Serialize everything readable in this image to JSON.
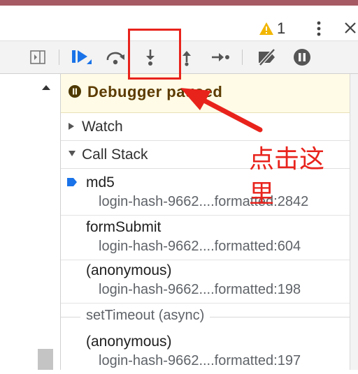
{
  "tabbar": {
    "warning_count": "1",
    "icons": [
      "warning-icon",
      "more-vertical-icon",
      "close-icon"
    ]
  },
  "toolbar": {
    "buttons": [
      {
        "name": "toggle-navigator",
        "icon": "panel-icon"
      },
      {
        "name": "resume",
        "icon": "resume-icon"
      },
      {
        "name": "step-over",
        "icon": "step-over-icon"
      },
      {
        "name": "step-into",
        "icon": "step-into-icon"
      },
      {
        "name": "step-out",
        "icon": "step-out-icon"
      },
      {
        "name": "step",
        "icon": "step-icon"
      },
      {
        "name": "deactivate-breakpoints",
        "icon": "breakpoint-off-icon"
      },
      {
        "name": "pause-on-exceptions",
        "icon": "pause-icon"
      }
    ]
  },
  "debugger": {
    "status": "Debugger paused",
    "watch_label": "Watch",
    "callstack_label": "Call Stack",
    "frames": [
      {
        "fn": "md5",
        "location": "login-hash-9662....formatted:2842",
        "current": true
      },
      {
        "fn": "formSubmit",
        "location": "login-hash-9662....formatted:604",
        "current": false
      },
      {
        "fn": "(anonymous)",
        "location": "login-hash-9662....formatted:198",
        "current": false
      },
      {
        "fn": "(anonymous)",
        "location": "login-hash-9662....formatted:197",
        "current": false
      }
    ],
    "async_label": "setTimeout (async)"
  },
  "annotation": {
    "text": "点击这里"
  },
  "colors": {
    "accent": "#1a73e8",
    "annotation": "#e8231c",
    "paused_bg": "#fffbe6",
    "top_strip": "#a65a63"
  }
}
